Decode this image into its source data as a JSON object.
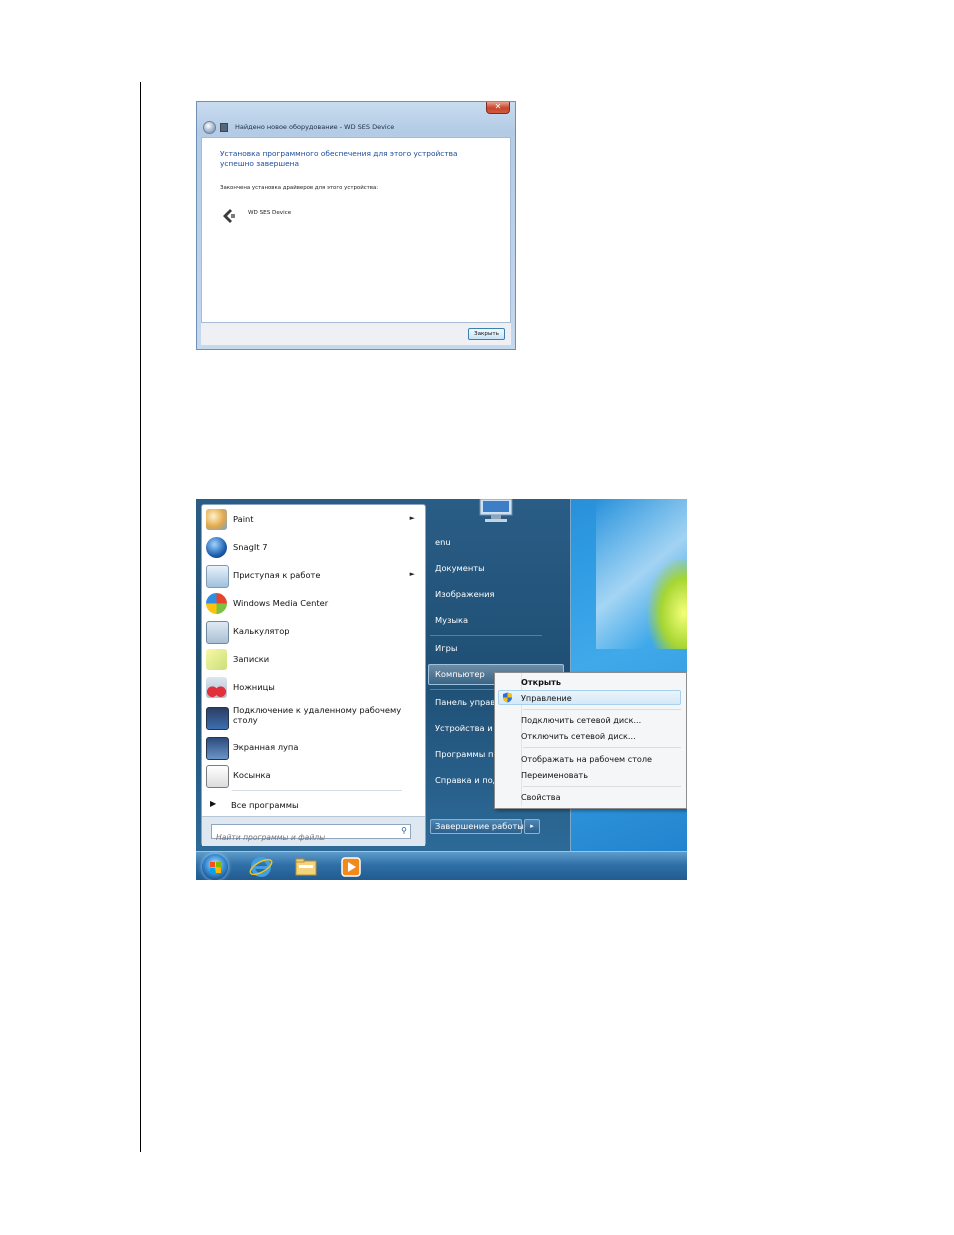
{
  "dialog": {
    "title": "Найдено новое оборудование - WD SES Device",
    "close_glyph": "✕",
    "heading": "Установка программного обеспечения для этого устройства успешно завершена",
    "subtext": "Закончена установка драйверов для этого устройства:",
    "device_name": "WD SES Device",
    "close_button": "Закрыть"
  },
  "start_menu": {
    "programs": [
      {
        "label": "Paint",
        "has_submenu": true
      },
      {
        "label": "SnagIt 7",
        "has_submenu": false
      },
      {
        "label": "Приступая к работе",
        "has_submenu": true
      },
      {
        "label": "Windows Media Center",
        "has_submenu": false
      },
      {
        "label": "Калькулятор",
        "has_submenu": false
      },
      {
        "label": "Записки",
        "has_submenu": false
      },
      {
        "label": "Ножницы",
        "has_submenu": false
      },
      {
        "label": "Подключение к удаленному рабочему столу",
        "has_submenu": false
      },
      {
        "label": "Экранная лупа",
        "has_submenu": false
      },
      {
        "label": "Косынка",
        "has_submenu": false
      }
    ],
    "submenu_arrow": "►",
    "all_programs": "Все программы",
    "search_placeholder": "Найти программы и файлы",
    "right_items": {
      "user": "enu",
      "documents": "Документы",
      "pictures": "Изображения",
      "music": "Музыка",
      "games": "Игры",
      "computer": "Компьютер",
      "control_panel": "Панель управ",
      "devices": "Устройства и п",
      "default_programs": "Программы п",
      "help": "Справка и под"
    },
    "shutdown": "Завершение работы",
    "shutdown_arrow": "▸"
  },
  "context_menu": {
    "open": "Открыть",
    "manage": "Управление",
    "map_drive": "Подключить сетевой диск...",
    "disconnect_drive": "Отключить сетевой диск...",
    "show_on_desktop": "Отображать на рабочем столе",
    "rename": "Переименовать",
    "properties": "Свойства"
  }
}
